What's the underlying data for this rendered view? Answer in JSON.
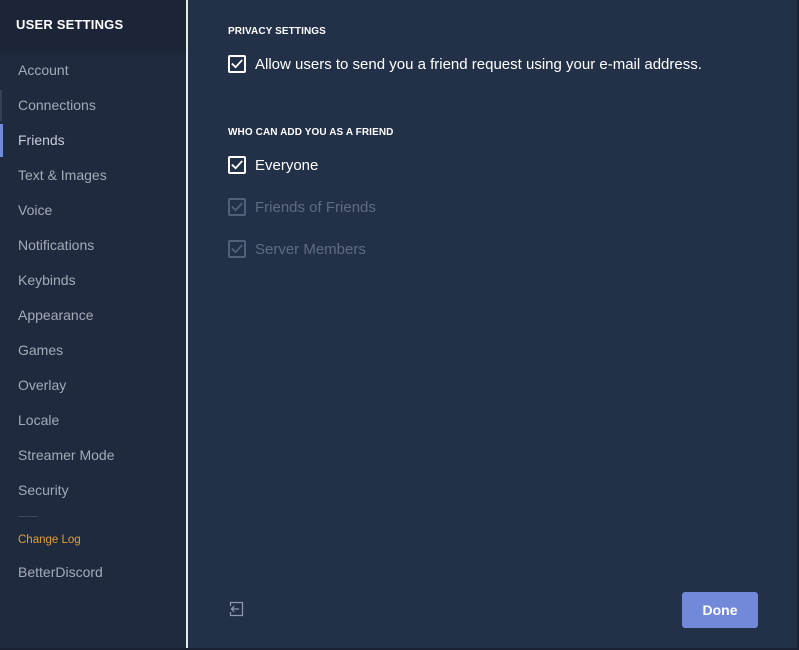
{
  "sidebar": {
    "header": "USER SETTINGS",
    "items": [
      {
        "label": "Account"
      },
      {
        "label": "Connections"
      },
      {
        "label": "Friends"
      },
      {
        "label": "Text & Images"
      },
      {
        "label": "Voice"
      },
      {
        "label": "Notifications"
      },
      {
        "label": "Keybinds"
      },
      {
        "label": "Appearance"
      },
      {
        "label": "Games"
      },
      {
        "label": "Overlay"
      },
      {
        "label": "Locale"
      },
      {
        "label": "Streamer Mode"
      },
      {
        "label": "Security"
      }
    ],
    "active_item": "Friends",
    "changelog": "Change Log",
    "plugin_item": "BetterDiscord"
  },
  "privacy": {
    "title": "PRIVACY SETTINGS",
    "allow_email_label": "Allow users to send you a friend request using your e-mail address.",
    "allow_email_checked": true
  },
  "who_can_add": {
    "title": "WHO CAN ADD YOU AS A FRIEND",
    "options": [
      {
        "label": "Everyone",
        "checked": true,
        "disabled": false
      },
      {
        "label": "Friends of Friends",
        "checked": true,
        "disabled": true
      },
      {
        "label": "Server Members",
        "checked": true,
        "disabled": true
      }
    ]
  },
  "footer": {
    "done_label": "Done",
    "logout_icon": "logout-icon"
  },
  "colors": {
    "accent": "#7289da",
    "changelog": "#e0a032"
  }
}
